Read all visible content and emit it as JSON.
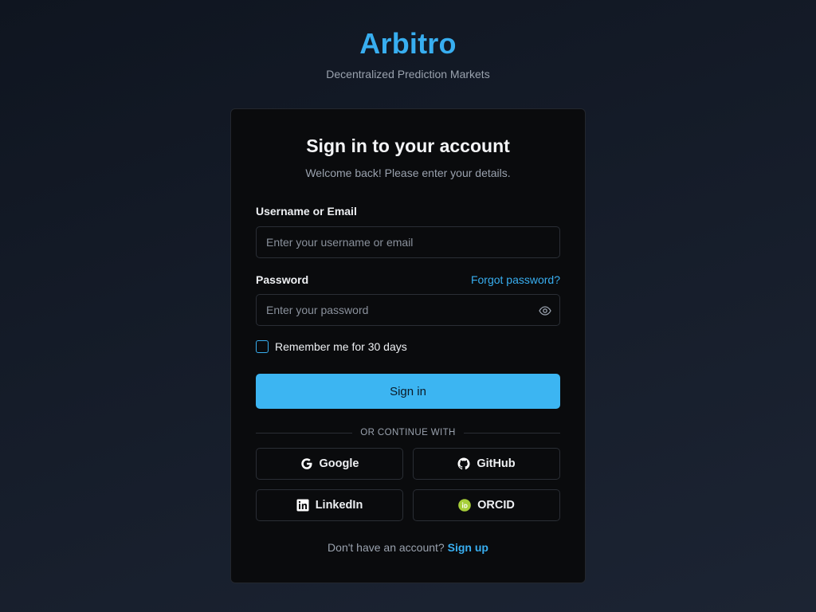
{
  "brand": {
    "title": "Arbitro",
    "subtitle": "Decentralized Prediction Markets"
  },
  "card": {
    "title": "Sign in to your account",
    "subtitle": "Welcome back! Please enter your details."
  },
  "username": {
    "label": "Username or Email",
    "placeholder": "Enter your username or email",
    "value": ""
  },
  "password": {
    "label": "Password",
    "forgot_label": "Forgot password?",
    "placeholder": "Enter your password",
    "value": "",
    "toggle_icon": "eye-icon"
  },
  "remember": {
    "label": "Remember me for 30 days",
    "checked": false
  },
  "signin_button": "Sign in",
  "divider": "OR CONTINUE WITH",
  "social": [
    {
      "label": "Google",
      "icon": "google-icon"
    },
    {
      "label": "GitHub",
      "icon": "github-icon"
    },
    {
      "label": "LinkedIn",
      "icon": "linkedin-icon"
    },
    {
      "label": "ORCID",
      "icon": "orcid-icon"
    }
  ],
  "footer": {
    "prompt": "Don't have an account?",
    "link": "Sign up"
  },
  "colors": {
    "accent": "#38aef0",
    "button": "#3cb5f2",
    "card_bg": "#0a0b0d",
    "orcid": "#a6ce39"
  }
}
